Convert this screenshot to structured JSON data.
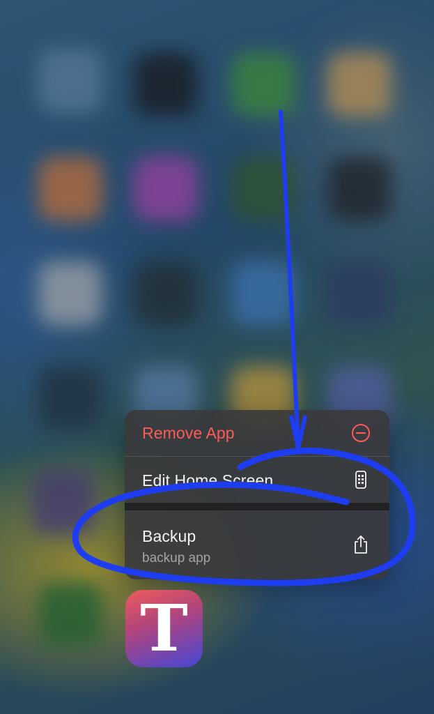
{
  "context_menu": {
    "remove_app": {
      "label": "Remove App",
      "icon": "minus-circle-icon",
      "color": "#ff5a55"
    },
    "edit_home_screen": {
      "label": "Edit Home Screen",
      "icon": "phone-apps-icon"
    },
    "backup": {
      "label": "Backup",
      "sublabel": "backup app",
      "icon": "share-icon"
    }
  },
  "app": {
    "letter": "T"
  },
  "annotation": {
    "color": "#1f3df0"
  }
}
